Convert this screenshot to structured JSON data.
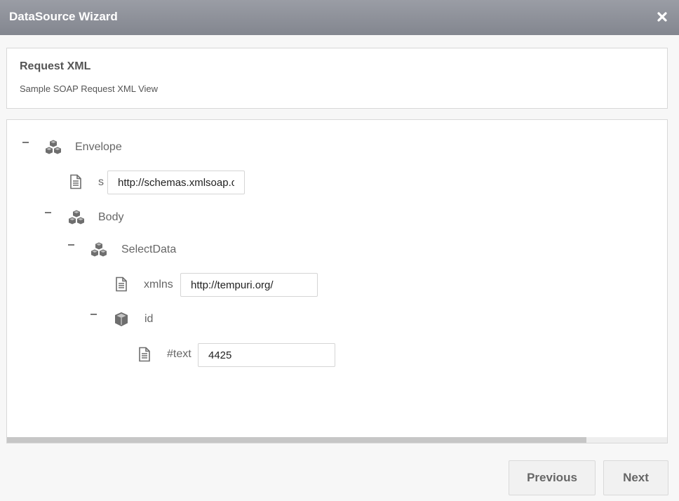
{
  "window": {
    "title": "DataSource Wizard",
    "close_icon": "close-icon"
  },
  "header": {
    "title": "Request XML",
    "subtitle": "Sample SOAP Request XML View"
  },
  "tree": {
    "envelope": {
      "label": "Envelope",
      "icon": "cubes-icon"
    },
    "envelope_attr": {
      "label": "s",
      "value": "http://schemas.xmlsoap.org/soap/envelope/",
      "icon": "document-icon"
    },
    "body": {
      "label": "Body",
      "icon": "cubes-icon"
    },
    "selectdata": {
      "label": "SelectData",
      "icon": "cubes-icon"
    },
    "xmlns_attr": {
      "label": "xmlns",
      "value": "http://tempuri.org/",
      "icon": "document-icon"
    },
    "id": {
      "label": "id",
      "icon": "cube-icon"
    },
    "text_attr": {
      "label": "#text",
      "value": "4425",
      "icon": "document-icon"
    }
  },
  "footer": {
    "previous_label": "Previous",
    "next_label": "Next"
  }
}
